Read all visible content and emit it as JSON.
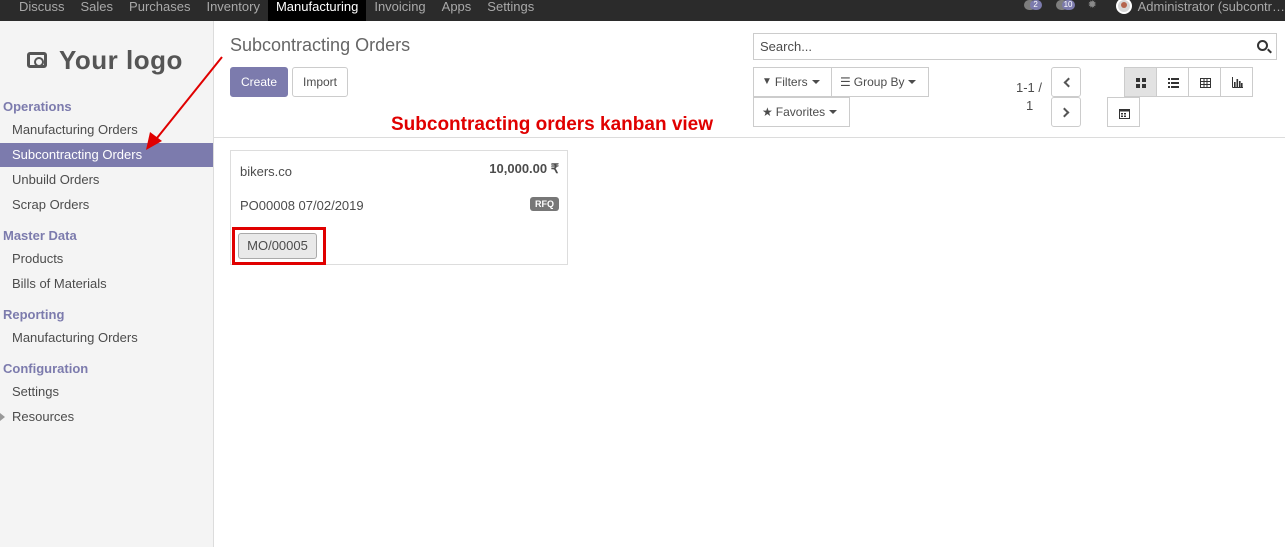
{
  "topbar": {
    "menu": [
      "Discuss",
      "Sales",
      "Purchases",
      "Inventory",
      "Manufacturing",
      "Invoicing",
      "Apps",
      "Settings"
    ],
    "active_menu": "Manufacturing",
    "activity_count": "2",
    "message_count": "10",
    "user_label": "Administrator (subcontr…"
  },
  "sidebar": {
    "logo_text": "Your logo",
    "sections": {
      "operations": "Operations",
      "master_data": "Master Data",
      "reporting": "Reporting",
      "configuration": "Configuration"
    },
    "items": {
      "manufacturing_orders": "Manufacturing Orders",
      "subcontracting_orders": "Subcontracting Orders",
      "unbuild_orders": "Unbuild Orders",
      "scrap_orders": "Scrap Orders",
      "products": "Products",
      "bills_of_materials": "Bills of Materials",
      "reporting_manufacturing_orders": "Manufacturing Orders",
      "settings": "Settings",
      "resources": "Resources"
    },
    "active_item": "Subcontracting Orders"
  },
  "control_panel": {
    "title": "Subcontracting Orders",
    "create_label": "Create",
    "import_label": "Import",
    "search_placeholder": "Search...",
    "filters_label": "Filters",
    "group_by_label": "Group By",
    "favorites_label": "Favorites",
    "pager_range": "1-1 /",
    "pager_total": "1",
    "views": [
      "kanban",
      "list",
      "grid",
      "graph",
      "calendar"
    ],
    "active_view": "kanban"
  },
  "annotation": {
    "text": "Subcontracting orders kanban view",
    "color": "#e00000"
  },
  "kanban": {
    "cards": [
      {
        "partner": "bikers.co",
        "amount": "10,000.00 ₹",
        "reference": "PO00008 07/02/2019",
        "state": "RFQ",
        "mo_button": "MO/00005"
      }
    ]
  },
  "colors": {
    "accent": "#7c7bad",
    "navbar": "#2b2b2b",
    "annotation_red": "#e00000"
  }
}
